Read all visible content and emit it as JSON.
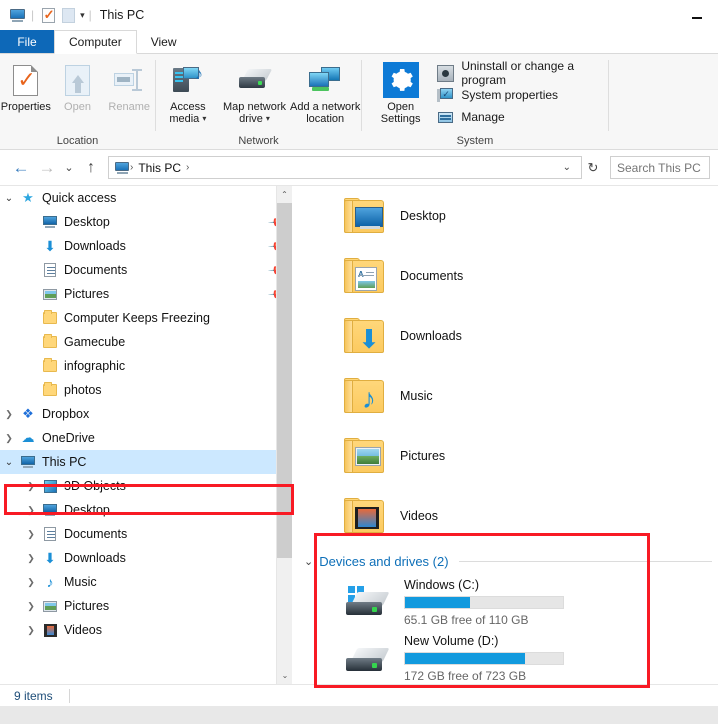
{
  "titlebar": {
    "title": "This PC",
    "quick_access_icons": [
      "monitor-icon",
      "properties-checklist-icon",
      "new-folder-icon"
    ],
    "dropdown_glyph": "▾",
    "minimize_label": "—"
  },
  "tabs": [
    {
      "label": "File",
      "state": "file"
    },
    {
      "label": "Computer",
      "state": "active"
    },
    {
      "label": "View",
      "state": "idle"
    }
  ],
  "ribbon": {
    "groups": [
      {
        "label": "Location",
        "buttons": [
          {
            "label": "Properties",
            "icon": "properties-icon",
            "disabled": false
          },
          {
            "label": "Open",
            "icon": "open-icon",
            "disabled": true
          },
          {
            "label": "Rename",
            "icon": "rename-icon",
            "disabled": true
          }
        ]
      },
      {
        "label": "Network",
        "buttons": [
          {
            "label": "Access media",
            "icon": "access-media-icon",
            "dropdown": true
          },
          {
            "label": "Map network drive",
            "icon": "map-network-drive-icon",
            "dropdown": true
          },
          {
            "label": "Add a network location",
            "icon": "add-network-location-icon",
            "dropdown": false
          }
        ]
      },
      {
        "label": "System",
        "big_button": {
          "label_line1": "Open",
          "label_line2": "Settings",
          "icon": "gear-icon"
        },
        "small_buttons": [
          {
            "label": "Uninstall or change a program",
            "icon": "uninstall-program-icon"
          },
          {
            "label": "System properties",
            "icon": "system-properties-icon"
          },
          {
            "label": "Manage",
            "icon": "manage-icon"
          }
        ]
      }
    ]
  },
  "addressbar": {
    "back_glyph": "←",
    "forward_glyph": "→",
    "history_glyph": "⌄",
    "up_glyph": "↑",
    "crumb_icon": "this-pc-icon",
    "crumbs": [
      "This PC"
    ],
    "crumb_separator": "›",
    "dropdown_glyph": "⌄",
    "refresh_glyph": "↻",
    "search_placeholder": "Search This PC"
  },
  "navpane": {
    "items": [
      {
        "label": "Quick access",
        "icon": "star-icon",
        "indent": 0,
        "chevron": "open",
        "pinned": false,
        "selected": false
      },
      {
        "label": "Desktop",
        "icon": "desktop-icon",
        "indent": 1,
        "chevron": "none",
        "pinned": true,
        "selected": false
      },
      {
        "label": "Downloads",
        "icon": "downloads-icon",
        "indent": 1,
        "chevron": "none",
        "pinned": true,
        "selected": false
      },
      {
        "label": "Documents",
        "icon": "documents-icon",
        "indent": 1,
        "chevron": "none",
        "pinned": true,
        "selected": false
      },
      {
        "label": "Pictures",
        "icon": "pictures-icon",
        "indent": 1,
        "chevron": "none",
        "pinned": true,
        "selected": false
      },
      {
        "label": "Computer Keeps Freezing",
        "icon": "folder-icon",
        "indent": 1,
        "chevron": "none",
        "pinned": false,
        "selected": false
      },
      {
        "label": "Gamecube",
        "icon": "folder-icon",
        "indent": 1,
        "chevron": "none",
        "pinned": false,
        "selected": false
      },
      {
        "label": "infographic",
        "icon": "folder-icon",
        "indent": 1,
        "chevron": "none",
        "pinned": false,
        "selected": false
      },
      {
        "label": "photos",
        "icon": "folder-icon",
        "indent": 1,
        "chevron": "none",
        "pinned": false,
        "selected": false
      },
      {
        "label": "Dropbox",
        "icon": "dropbox-icon",
        "indent": 0,
        "chevron": "closed",
        "pinned": false,
        "selected": false
      },
      {
        "label": "OneDrive",
        "icon": "onedrive-icon",
        "indent": 0,
        "chevron": "closed",
        "pinned": false,
        "selected": false
      },
      {
        "label": "This PC",
        "icon": "this-pc-icon",
        "indent": 0,
        "chevron": "open",
        "pinned": false,
        "selected": true
      },
      {
        "label": "3D Objects",
        "icon": "3d-objects-icon",
        "indent": 1,
        "chevron": "closed",
        "pinned": false,
        "selected": false
      },
      {
        "label": "Desktop",
        "icon": "desktop-icon",
        "indent": 1,
        "chevron": "closed",
        "pinned": false,
        "selected": false
      },
      {
        "label": "Documents",
        "icon": "documents-icon",
        "indent": 1,
        "chevron": "closed",
        "pinned": false,
        "selected": false
      },
      {
        "label": "Downloads",
        "icon": "downloads-icon",
        "indent": 1,
        "chevron": "closed",
        "pinned": false,
        "selected": false
      },
      {
        "label": "Music",
        "icon": "music-icon",
        "indent": 1,
        "chevron": "closed",
        "pinned": false,
        "selected": false
      },
      {
        "label": "Pictures",
        "icon": "pictures-icon",
        "indent": 1,
        "chevron": "closed",
        "pinned": false,
        "selected": false
      },
      {
        "label": "Videos",
        "icon": "videos-icon",
        "indent": 1,
        "chevron": "closed",
        "pinned": false,
        "selected": false
      }
    ],
    "scroll_up_glyph": "⌃",
    "scroll_down_glyph": "⌄"
  },
  "content": {
    "folders": [
      {
        "name": "Desktop",
        "icon": "folder-desktop-icon"
      },
      {
        "name": "Documents",
        "icon": "folder-documents-icon"
      },
      {
        "name": "Downloads",
        "icon": "folder-downloads-icon"
      },
      {
        "name": "Music",
        "icon": "folder-music-icon"
      },
      {
        "name": "Pictures",
        "icon": "folder-pictures-icon"
      },
      {
        "name": "Videos",
        "icon": "folder-videos-icon"
      }
    ],
    "devices_section": {
      "chevron": "⌄",
      "title": "Devices and drives (2)",
      "drives": [
        {
          "name": "Windows (C:)",
          "capacity_text": "65.1 GB free of 110 GB",
          "used_percent": 41,
          "icon": "windows-drive-icon",
          "bar_color": "#129ade"
        },
        {
          "name": "New Volume (D:)",
          "capacity_text": "172 GB free of 723 GB",
          "used_percent": 76,
          "icon": "drive-icon",
          "bar_color": "#129ade"
        }
      ]
    }
  },
  "statusbar": {
    "item_count": "9 items"
  },
  "annotations": {
    "accent_color": "#f81a24",
    "highlight_color": "#cce8ff",
    "boxes": [
      "this-pc-nav-item",
      "devices-and-drives-section"
    ]
  }
}
